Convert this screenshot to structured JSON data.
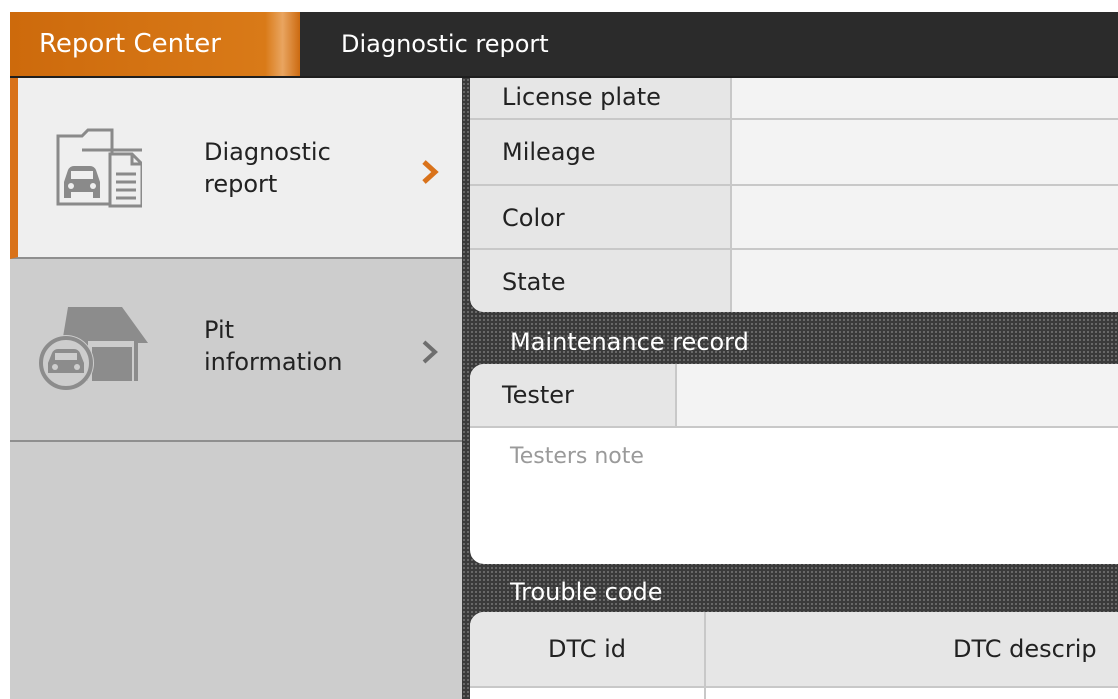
{
  "header": {
    "app_title": "Report Center",
    "page_title": "Diagnostic report"
  },
  "sidebar": {
    "items": [
      {
        "label_line1": "Diagnostic",
        "label_line2": "report",
        "icon": "car-report-folder-icon",
        "active": true
      },
      {
        "label_line1": "Pit",
        "label_line2": "information",
        "icon": "garage-car-icon",
        "active": false
      }
    ]
  },
  "vehicle_info": {
    "rows": [
      {
        "label": "License plate",
        "value": ""
      },
      {
        "label": "Mileage",
        "value": ""
      },
      {
        "label": "Color",
        "value": ""
      },
      {
        "label": "State",
        "value": ""
      }
    ]
  },
  "maintenance": {
    "section_title": "Maintenance record",
    "tester_label": "Tester",
    "tester_value": "",
    "notes_placeholder": "Testers note"
  },
  "trouble_code": {
    "section_title": "Trouble code",
    "columns": [
      "DTC id",
      "DTC descrip"
    ]
  },
  "colors": {
    "accent": "#cf6d10",
    "topbar": "#2b2b2b",
    "sidebar_active": "#efefef",
    "sidebar_inactive": "#cdcdcd"
  }
}
